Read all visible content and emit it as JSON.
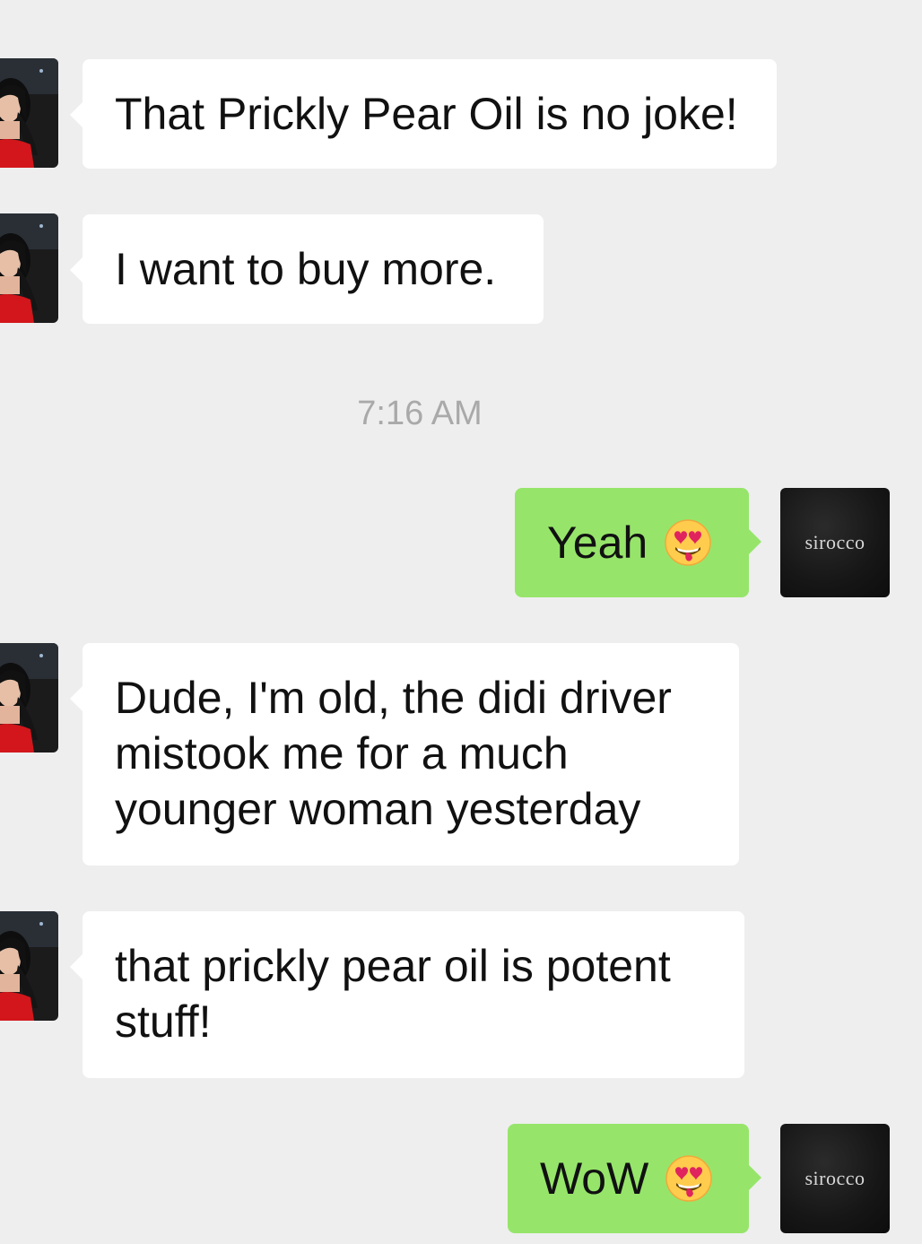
{
  "messages": [
    {
      "side": "in",
      "text": "That Prickly Pear Oil is no joke!"
    },
    {
      "side": "in",
      "text": "I want to buy more."
    },
    {
      "side": "out",
      "text": "Yeah",
      "emoji": "heart-eyes-tongue-emoji"
    },
    {
      "side": "in",
      "text": "Dude, I'm old, the didi driver mistook me for a much younger woman yesterday"
    },
    {
      "side": "in",
      "text": "that prickly pear oil is potent stuff!"
    },
    {
      "side": "out",
      "text": "WoW",
      "emoji": "heart-eyes-tongue-emoji"
    }
  ],
  "timestamp": "7:16 AM",
  "me_avatar": {
    "logo_text": "sirocco"
  },
  "colors": {
    "background": "#eeeeee",
    "incoming_bubble": "#ffffff",
    "outgoing_bubble": "#96e56a",
    "timestamp_text": "#a9a9a9"
  }
}
